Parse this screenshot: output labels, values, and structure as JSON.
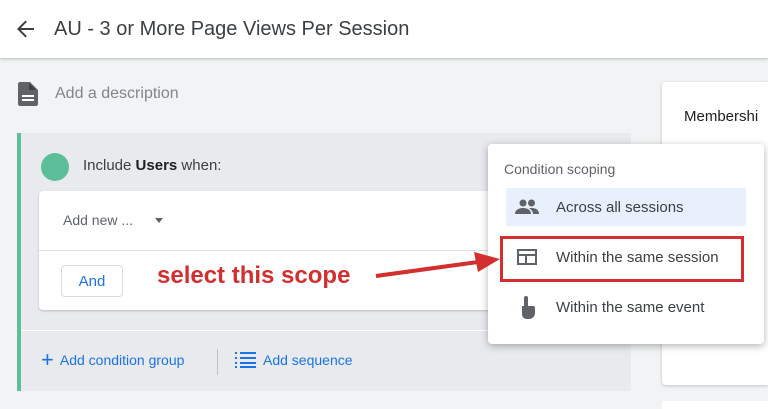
{
  "header": {
    "title": "AU - 3 or More Page Views Per Session"
  },
  "description": {
    "placeholder": "Add a description"
  },
  "condition_group": {
    "include_prefix": "Include",
    "include_subject": "Users",
    "include_suffix": "when:",
    "add_new_label": "Add new ...",
    "and_label": "And"
  },
  "footer_actions": {
    "add_condition_group": "Add condition group",
    "add_sequence": "Add sequence"
  },
  "right_panel": {
    "membership_label": "Membershi"
  },
  "scoping_menu": {
    "title": "Condition scoping",
    "options": [
      {
        "label": "Across all sessions",
        "icon": "people-icon",
        "selected": true
      },
      {
        "label": "Within the same session",
        "icon": "session-window-icon",
        "selected": false
      },
      {
        "label": "Within the same event",
        "icon": "touch-hand-icon",
        "selected": false
      }
    ]
  },
  "annotation": {
    "text": "select this scope"
  },
  "colors": {
    "accent_green": "#5bbf9a",
    "link_blue": "#1a73e8",
    "annotation_red": "#d32f2f",
    "selected_bg": "#e8f0fe"
  }
}
